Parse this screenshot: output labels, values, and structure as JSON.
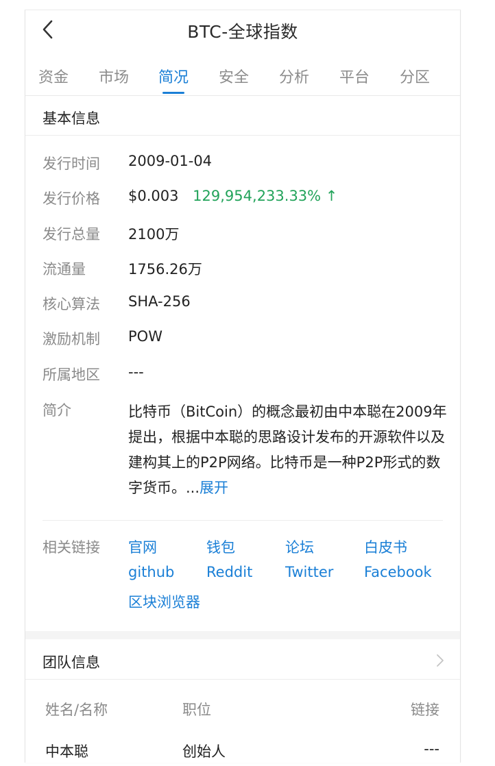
{
  "header": {
    "title": "BTC-全球指数"
  },
  "tabs": [
    "资金",
    "市场",
    "简况",
    "安全",
    "分析",
    "平台",
    "分区"
  ],
  "basic": {
    "section_title": "基本信息",
    "rows": [
      {
        "k": "发行时间",
        "v": "2009-01-04"
      },
      {
        "k": "发行价格",
        "v": "$0.003",
        "change": "129,954,233.33% ↑"
      },
      {
        "k": "发行总量",
        "v": "2100万"
      },
      {
        "k": "流通量",
        "v": "1756.26万"
      },
      {
        "k": "核心算法",
        "v": "SHA-256"
      },
      {
        "k": "激励机制",
        "v": "POW"
      },
      {
        "k": "所属地区",
        "v": "---"
      }
    ],
    "intro_label": "简介",
    "intro_text": "比特币（BitCoin）的概念最初由中本聪在2009年提出，根据中本聪的思路设计发布的开源软件以及建构其上的P2P网络。比特币是一种P2P形式的数字货币。...",
    "intro_more": "展开",
    "links_label": "相关链接",
    "links": [
      "官网",
      "钱包",
      "论坛",
      "白皮书",
      "github",
      "Reddit",
      "Twitter",
      "Facebook",
      "区块浏览器"
    ]
  },
  "team": {
    "section_title": "团队信息",
    "columns": [
      "姓名/名称",
      "职位",
      "链接"
    ],
    "rows": [
      {
        "name": "中本聪",
        "role": "创始人",
        "link": "---"
      }
    ]
  },
  "colors": {
    "accent": "#1a7fd6",
    "up": "#22a35a"
  }
}
